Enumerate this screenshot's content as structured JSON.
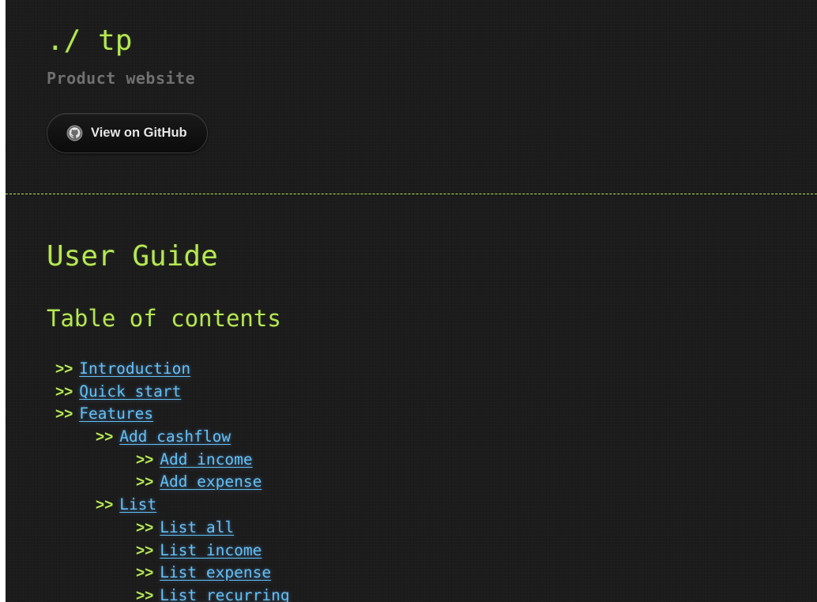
{
  "header": {
    "title": "./ tp",
    "subtitle": "Product website",
    "github_button_label": "View on GitHub",
    "github_icon": "github-icon"
  },
  "main": {
    "title": "User Guide",
    "toc_title": "Table of contents",
    "toc_arrow": ">>",
    "toc": [
      {
        "label": "Introduction",
        "level": 0
      },
      {
        "label": "Quick start",
        "level": 0
      },
      {
        "label": "Features",
        "level": 0
      },
      {
        "label": "Add cashflow",
        "level": 1
      },
      {
        "label": "Add income",
        "level": 2
      },
      {
        "label": "Add expense",
        "level": 2
      },
      {
        "label": "List",
        "level": 1
      },
      {
        "label": "List all",
        "level": 2
      },
      {
        "label": "List income",
        "level": 2
      },
      {
        "label": "List expense",
        "level": 2
      },
      {
        "label": "List recurring",
        "level": 2
      }
    ]
  },
  "colors": {
    "background": "#1c1c1c",
    "accent_green": "#b5e853",
    "link_blue": "#63c0f5",
    "subtitle_gray": "#707070"
  }
}
